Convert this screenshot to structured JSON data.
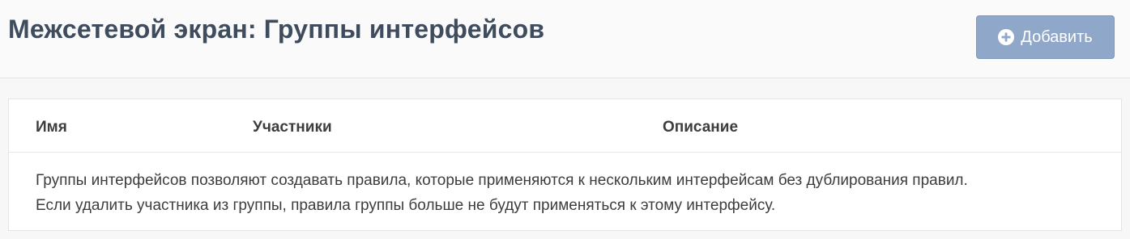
{
  "header": {
    "title": "Межсетевой экран: Группы интерфейсов",
    "add_button_label": "Добавить",
    "add_icon": "plus-circle-icon"
  },
  "table": {
    "columns": [
      "Имя",
      "Участники",
      "Описание"
    ],
    "info_lines": [
      "Группы интерфейсов позволяют создавать правила, которые применяются к нескольким интерфейсам без дублирования правил.",
      "Если удалить участника из группы, правила группы больше не будут применяться к этому интерфейсу."
    ]
  },
  "colors": {
    "title": "#3f4c5e",
    "button_bg": "#8fa7c8",
    "button_text": "#ffffff",
    "page_bg": "#f7f7f7",
    "panel_bg": "#ffffff"
  }
}
